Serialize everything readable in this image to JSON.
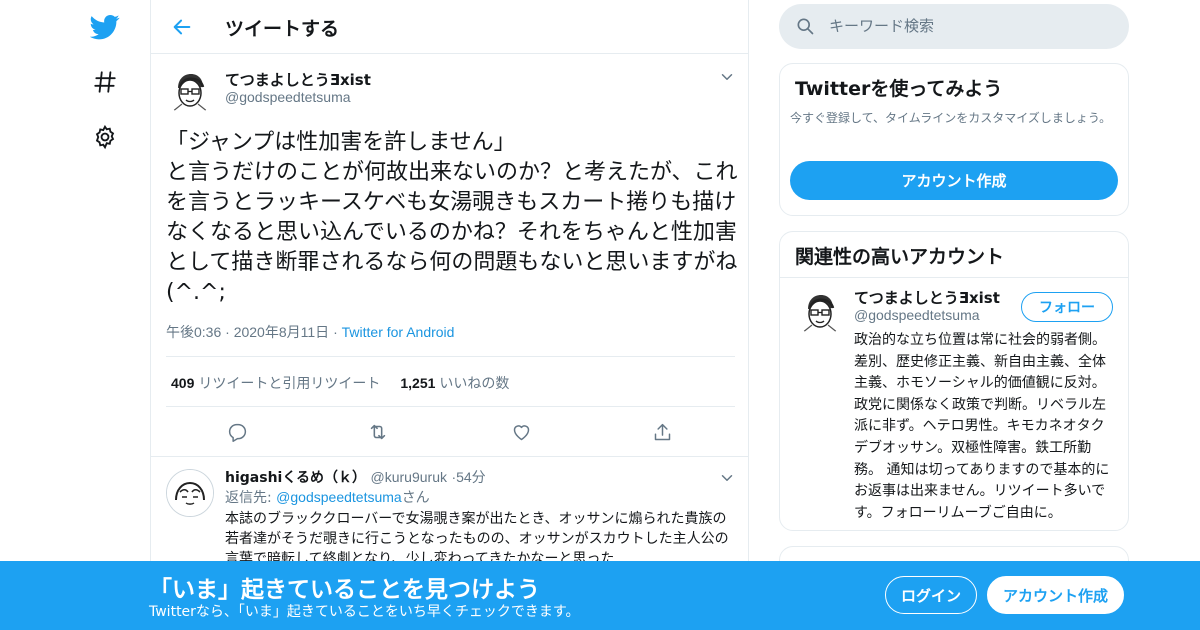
{
  "colors": {
    "brand": "#1da1f2",
    "text": "#14171a",
    "muted": "#657786",
    "link": "#1b95e0",
    "border": "#e6ecf0"
  },
  "nav": {
    "logo_icon": "twitter-bird-icon",
    "explore_icon": "hashtag-icon",
    "settings_icon": "gear-icon"
  },
  "header": {
    "back_icon": "arrow-left-icon",
    "title": "ツイートする"
  },
  "tweet": {
    "name": "てつまよしとうƎxist",
    "handle": "@godspeedtetsuma",
    "text": "「ジャンプは性加害を許しません」\nと言うだけのことが何故出来ないのか？と考えたが、これを言うとラッキースケベも女湯覗きもスカート捲りも描けなくなると思い込んでいるのかね？それをちゃんと性加害として描き断罪されるなら何の問題もないと思いますがね(^.^;",
    "time": "午後0:36",
    "date": "2020年8月11日",
    "separator": "·",
    "source": "Twitter for Android",
    "retweets_count": "409",
    "retweets_label": "リツイートと引用リツイート",
    "likes_count": "1,251",
    "likes_label": "いいねの数"
  },
  "reply": {
    "name": "higashiくるめ（ｋ）",
    "handle": "@kuru9uruk",
    "separator": "·",
    "time_ago": "54分",
    "reply_to_label": "返信先:",
    "reply_to_handle": "@godspeedtetsuma",
    "reply_to_suffix": "さん",
    "text": "本誌のブラッククローバーで女湯覗き案が出たとき、オッサンに煽られた貴族の若者達がそうだ覗きに行こうとなったものの、オッサンがスカウトした主人公の言葉で暗転して終劇となり、少し変わってきたかなーと思った"
  },
  "search": {
    "placeholder": "キーワード検索"
  },
  "signup_card": {
    "title": "Twitterを使ってみよう",
    "description": "今すぐ登録して、タイムラインをカスタマイズしましょう。",
    "button": "アカウント作成"
  },
  "related": {
    "title": "関連性の高いアカウント",
    "name": "てつまよしとうƎxist",
    "handle": "@godspeedtetsuma",
    "follow_button": "フォロー",
    "bio": "政治的な立ち位置は常に社会的弱者側。 差別、歴史修正主義、新自由主義、全体主義、ホモソーシャル的価値観に反対。政党に関係なく政策で判断。リベラル左派に非ず。ヘテロ男性。キモカネオタクデブオッサン。双極性障害。鉄工所勤務。 通知は切ってありますので基本的にお返事は出来ません。リツイート多いです。フォローリムーブご自由に。"
  },
  "banner": {
    "title": "「いま」起きていることを見つけよう",
    "subtitle": "Twitterなら、「いま」起きていることをいち早くチェックできます。",
    "login_button": "ログイン",
    "signup_button": "アカウント作成"
  }
}
